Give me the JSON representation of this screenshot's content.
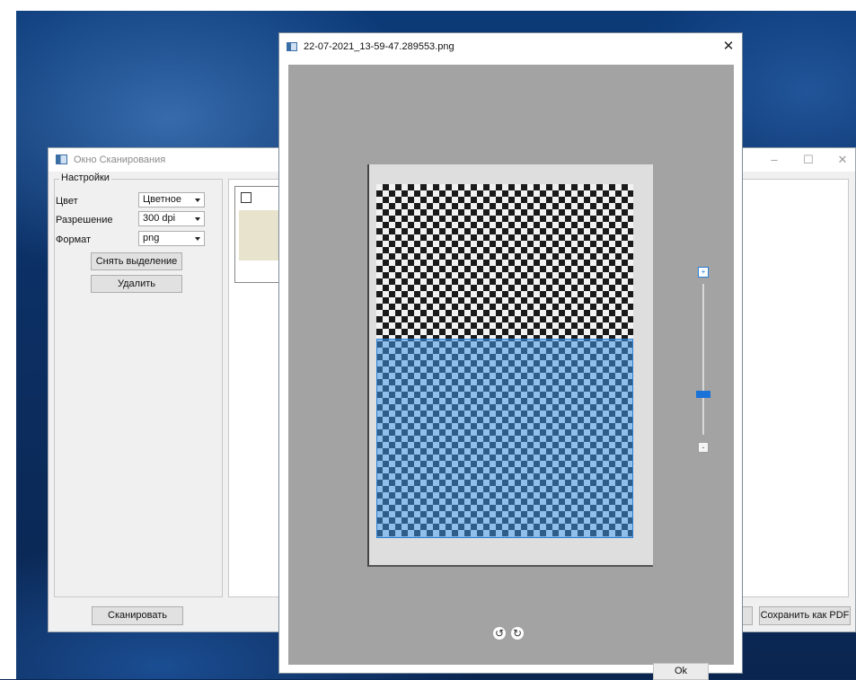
{
  "scan_window": {
    "title": "Окно Сканирования",
    "minimize": "–",
    "maximize": "☐",
    "close": "✕",
    "settings_title": "Настройки",
    "settings": [
      {
        "label": "Цвет",
        "value": "Цветное"
      },
      {
        "label": "Разрешение",
        "value": "300 dpi"
      },
      {
        "label": "Формат",
        "value": "png"
      }
    ],
    "clear_selection_button": "Снять выделение",
    "delete_button": "Удалить",
    "scan_button": "Сканировать",
    "save_pdf_button": "Сохранить как PDF"
  },
  "image_dialog": {
    "title": "22-07-2021_13-59-47.289553.png",
    "close": "✕",
    "zoom_in": "+",
    "zoom_out": "-",
    "zoom_level": 0.27,
    "rotate_left": "↺",
    "rotate_right": "↻",
    "ok_button": "Ok",
    "selection_color": "#4196e6"
  }
}
